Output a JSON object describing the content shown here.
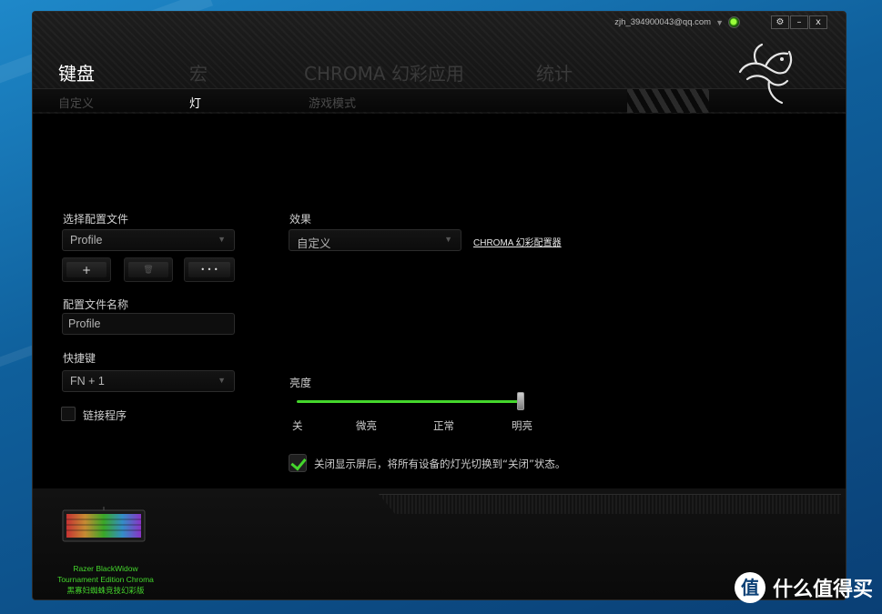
{
  "account": {
    "email": "zjh_394900043@qq.com"
  },
  "window_controls": {
    "settings": "⚙",
    "minimize": "–",
    "close": "x"
  },
  "main_tabs": [
    {
      "label": "键盘",
      "active": true
    },
    {
      "label": "宏",
      "active": false
    },
    {
      "label": "CHROMA 幻彩应用",
      "active": false
    },
    {
      "label": "统计",
      "active": false
    }
  ],
  "sub_tabs": [
    {
      "label": "自定义",
      "active": false
    },
    {
      "label": "灯",
      "active": true
    },
    {
      "label": "游戏模式",
      "active": false
    }
  ],
  "profile": {
    "select_label": "选择配置文件",
    "selected": "Profile",
    "add_button": "+",
    "delete_button": "🗑",
    "more_button": "• • •",
    "name_label": "配置文件名称",
    "name_value": "Profile",
    "hotkey_label": "快捷键",
    "hotkey_value": "FN + 1",
    "link_program_label": "链接程序",
    "link_program_checked": false
  },
  "effect": {
    "label": "效果",
    "selected": "自定义",
    "configurator_link": "CHROMA 幻彩配置器"
  },
  "brightness": {
    "label": "亮度",
    "level": 1.0,
    "ticks": [
      "关",
      "微亮",
      "正常",
      "明亮"
    ]
  },
  "screen_off": {
    "checked": true,
    "text": "关闭显示屏后，将所有设备的灯光切换到“关闭”状态。"
  },
  "device": {
    "name_line1": "Razer BlackWidow",
    "name_line2": "Tournament Edition Chroma",
    "name_line3": "黑寡妇蜘蛛竞技幻彩版"
  },
  "watermark": {
    "text": "什么值得买",
    "badge": "值"
  },
  "colors": {
    "accent": "#44d62c",
    "background": "#000000"
  }
}
